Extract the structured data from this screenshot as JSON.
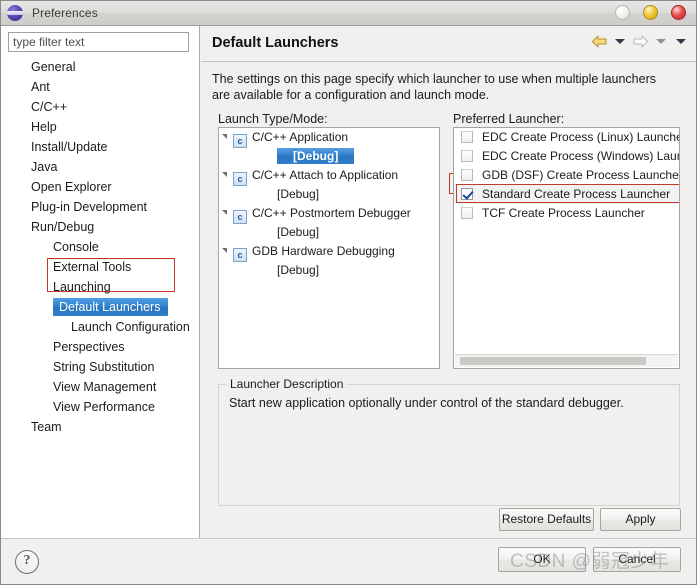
{
  "window": {
    "title": "Preferences",
    "icon": "eclipse-sphere-icon",
    "controls": {
      "minimize": "minimize-button",
      "maximize": "maximize-button",
      "close": "close-button"
    }
  },
  "sidebar": {
    "filter": {
      "value": "",
      "placeholder": "type filter text"
    },
    "items": [
      {
        "label": "General",
        "level": 1,
        "selected": false
      },
      {
        "label": "Ant",
        "level": 1,
        "selected": false
      },
      {
        "label": "C/C++",
        "level": 1,
        "selected": false
      },
      {
        "label": "Help",
        "level": 1,
        "selected": false
      },
      {
        "label": "Install/Update",
        "level": 1,
        "selected": false
      },
      {
        "label": "Java",
        "level": 1,
        "selected": false
      },
      {
        "label": "Open Explorer",
        "level": 1,
        "selected": false
      },
      {
        "label": "Plug-in Development",
        "level": 1,
        "selected": false
      },
      {
        "label": "Run/Debug",
        "level": 1,
        "selected": false
      },
      {
        "label": "Console",
        "level": 2,
        "selected": false
      },
      {
        "label": "External Tools",
        "level": 2,
        "selected": false
      },
      {
        "label": "Launching",
        "level": 2,
        "selected": false
      },
      {
        "label": "Default Launchers",
        "level": 3,
        "selected": true
      },
      {
        "label": "Launch Configuration",
        "level": 3,
        "selected": false
      },
      {
        "label": "Perspectives",
        "level": 2,
        "selected": false
      },
      {
        "label": "String Substitution",
        "level": 2,
        "selected": false
      },
      {
        "label": "View Management",
        "level": 2,
        "selected": false
      },
      {
        "label": "View Performance",
        "level": 2,
        "selected": false
      },
      {
        "label": "Team",
        "level": 1,
        "selected": false
      }
    ]
  },
  "page": {
    "title": "Default Launchers",
    "description": "The settings on this page specify which launcher to use when multiple launchers are available for a configuration and launch mode.",
    "nav": {
      "back": "back-arrow-icon",
      "back_menu": "back-dropdown-icon",
      "forward": "forward-arrow-icon",
      "forward_menu": "forward-dropdown-icon",
      "more": "more-dropdown-icon"
    }
  },
  "launch_types": {
    "label": "Launch Type/Mode:",
    "groups": [
      {
        "name": "C/C++ Application",
        "icon": "c-file-icon",
        "mode": "[Debug]",
        "mode_selected": true,
        "mode_annotated": true
      },
      {
        "name": "C/C++ Attach to Application",
        "icon": "c-file-icon",
        "mode": "[Debug]",
        "mode_selected": false,
        "mode_annotated": true
      },
      {
        "name": "C/C++ Postmortem Debugger",
        "icon": "c-file-icon",
        "mode": "[Debug]",
        "mode_selected": false,
        "mode_annotated": true
      },
      {
        "name": "GDB Hardware Debugging",
        "icon": "c-file-icon",
        "mode": "[Debug]",
        "mode_selected": false,
        "mode_annotated": false
      }
    ]
  },
  "preferred_launcher": {
    "label": "Preferred Launcher:",
    "options": [
      {
        "label": "EDC Create Process (Linux) Launcher",
        "checked": false,
        "annotated": false
      },
      {
        "label": "EDC Create Process (Windows) Launch",
        "checked": false,
        "annotated": false
      },
      {
        "label": "GDB (DSF) Create Process Launcher",
        "checked": false,
        "annotated": false
      },
      {
        "label": "Standard Create Process Launcher",
        "checked": true,
        "annotated": true
      },
      {
        "label": "TCF Create Process Launcher",
        "checked": false,
        "annotated": false
      }
    ]
  },
  "launcher_description": {
    "legend": "Launcher Description",
    "text": "Start new application optionally under control of the standard debugger."
  },
  "buttons": {
    "restore_defaults": "Restore Defaults",
    "apply": "Apply",
    "ok": "OK",
    "cancel": "Cancel",
    "help": "?"
  },
  "watermark": "CSDN @弱冠少年",
  "colors": {
    "selection_blue": "#2f7ec9",
    "annotation_red": "#c0392b",
    "dialog_bg": "#f1f0ee",
    "close_red": "#e8504f",
    "maximize_yellow": "#f2c93c"
  }
}
